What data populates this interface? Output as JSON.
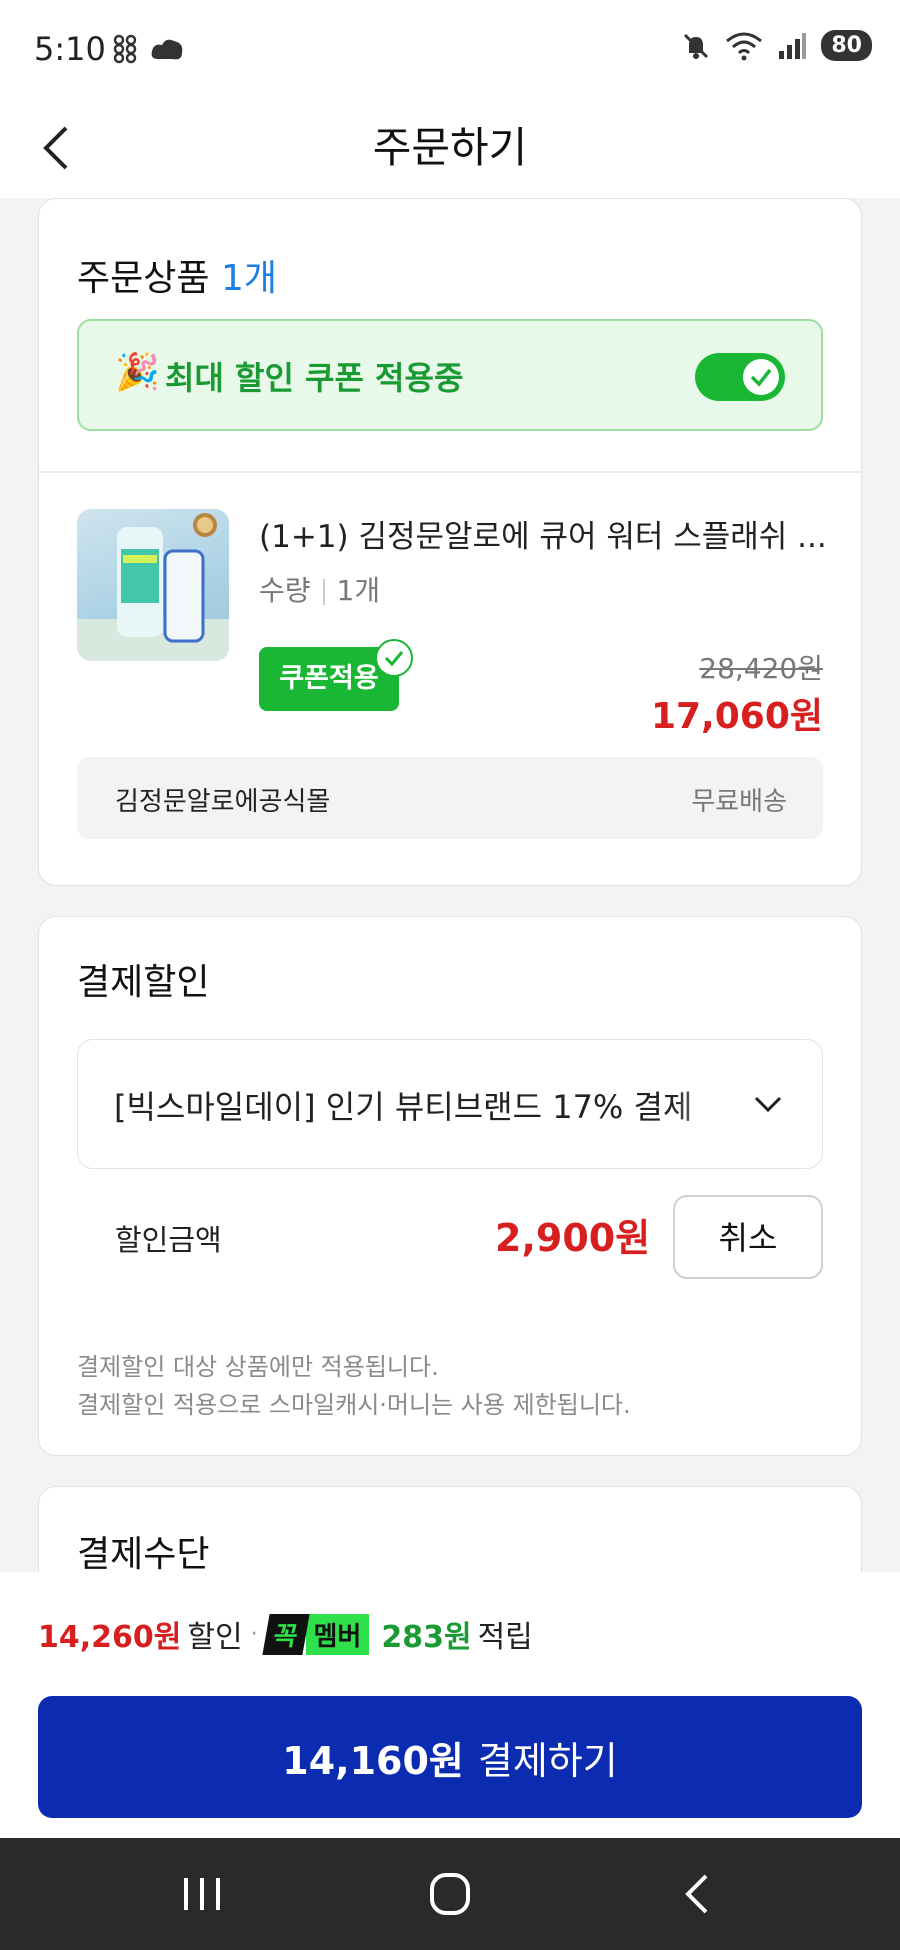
{
  "status_bar": {
    "time": "5:10",
    "battery": "80",
    "icons": [
      "app-icon",
      "cloud-icon",
      "mute-icon",
      "wifi-icon",
      "signal-icon"
    ]
  },
  "header": {
    "title": "주문하기",
    "back_icon": "chevron-left-icon"
  },
  "order": {
    "title": "주문상품",
    "count": "1개",
    "coupon_banner": {
      "emoji": "🎉",
      "text": "최대 할인 쿠폰 적용중",
      "enabled": true
    },
    "product": {
      "name": "(1+1) 김정문알로에 큐어 워터 스플래쉬 ...",
      "qty_label": "수량",
      "qty_value": "1개",
      "coupon_badge": "쿠폰적용",
      "original_price": "28,420원",
      "sale_price": "17,060원"
    },
    "seller": {
      "name": "김정문알로에공식몰",
      "shipping": "무료배송"
    }
  },
  "discount": {
    "title": "결제할인",
    "selected_option": "[빅스마일데이] 인기 뷰티브랜드 17% 결제",
    "amount_label": "할인금액",
    "amount": "2,900원",
    "cancel_label": "취소",
    "note1": "결제할인 대상 상품에만 적용됩니다.",
    "note2": "결제할인 적용으로 스마일캐시·머니는 사용 제한됩니다."
  },
  "payment": {
    "title": "결제수단"
  },
  "bottom": {
    "discount_total": "14,260원",
    "discount_word": "할인",
    "dot": "·",
    "member_k": "꼭",
    "member_label": "멤버",
    "points": "283원",
    "points_word": "적립",
    "pay_amount": "14,160원",
    "pay_label": "결제하기"
  },
  "colors": {
    "accent_blue": "#0b2bb0",
    "green": "#1ab734",
    "red": "#d81f1f",
    "count_blue": "#1c7ee6"
  },
  "nav": [
    "recent-apps-icon",
    "home-icon",
    "back-icon"
  ]
}
